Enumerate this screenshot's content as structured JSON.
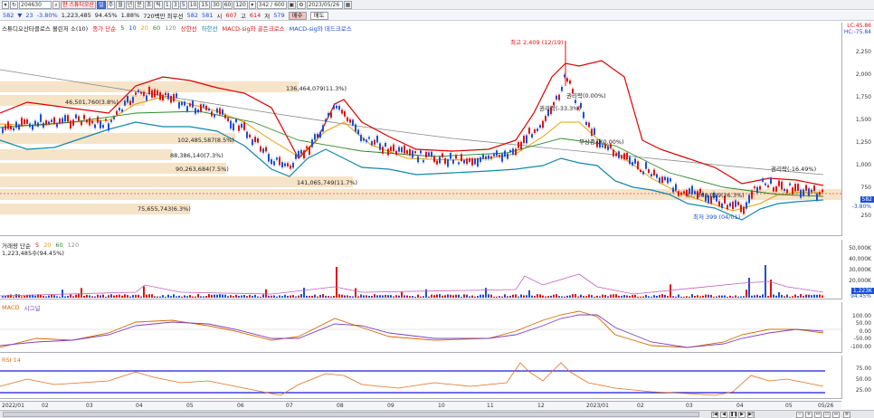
{
  "toolbar": {
    "code": "204630",
    "name": "한 스튜디오산",
    "periods": [
      "주",
      "월",
      "년",
      "분",
      "초",
      "틱"
    ],
    "intervals": [
      "1",
      "3",
      "5",
      "10",
      "15",
      "30",
      "60",
      "120"
    ],
    "count": "342 / 600",
    "date": "2023/05/26"
  },
  "info": {
    "price": "582",
    "change": "23",
    "change_pct": "-3.80%",
    "volume": "1,223,485",
    "vol_pct": "94.45%",
    "turnover": "1.88%",
    "label": "720백만 최우선",
    "ask": "582",
    "bid": "581",
    "high_label": "시",
    "high": "607",
    "close_label": "고",
    "close": "614",
    "low_label": "저",
    "low": "579",
    "buy_btn": "매수",
    "sell_btn": "매도"
  },
  "price_legend": {
    "name": "스튜디오산타클로스 볼린저 소(10)",
    "ma_label": "종가 단순",
    "ma": [
      "5",
      "10",
      "20",
      "60",
      "120"
    ],
    "up": "상한선",
    "down": "하한선",
    "macd1": "MACD-sig와 골든크로스",
    "macd2": "MACD-sig와 데드크로스"
  },
  "price_axis": {
    "ticks": [
      "2,250",
      "2,000",
      "1,750",
      "1,500",
      "1,250",
      "1,000",
      "750",
      "500",
      "250"
    ],
    "lc": "LC:45.86",
    "hc": "HC:-75.84",
    "tag1": "582",
    "tag2": "-3.80%"
  },
  "annotations": {
    "a1": "136,464,079(11.3%)",
    "a2": "46,501,760(3.8%)",
    "a3": "102,485,587(8.5%)",
    "a4": "88,386,140(7.3%)",
    "a5": "90,263,684(7.5%)",
    "a6": "75,655,743(6.3%)",
    "a7": "141,065,749(11.7%)",
    "a8": "최고 2,409 (12/19)",
    "a9": "권리락(0.00%)",
    "a10": "권리락(-33.3%)",
    "a11": "무상증자(0.00%)",
    "a12": "권리락(-16.49%)",
    "a13": "최저 399 (04/01)",
    "a14": "(?, 368,019(26.3%)"
  },
  "volume_legend": {
    "label": "거래량 단순",
    "ma": [
      "5",
      "20",
      "60",
      "120"
    ],
    "value": "1,223,485수(94.45%)"
  },
  "volume_axis": {
    "ticks": [
      "50,000K",
      "40,000K",
      "30,000K",
      "20,000K",
      "10,000K"
    ],
    "tag1": "1,223K",
    "tag2": "94.45%"
  },
  "macd_legend": {
    "label": "MACD",
    "sig": "시그널"
  },
  "macd_axis": {
    "ticks": [
      "100.00",
      "50.00",
      "0.00",
      "-50.00",
      "-100.00"
    ]
  },
  "rsi_legend": {
    "label": "RSI 14"
  },
  "rsi_axis": {
    "ticks": [
      "75.00",
      "50.00",
      "25.00"
    ]
  },
  "xaxis": [
    "2022/01",
    "02",
    "03",
    "04",
    "05",
    "06",
    "07",
    "08",
    "09",
    "10",
    "11",
    "12",
    "2023/01",
    "02",
    "03",
    "04",
    "05",
    "05/26"
  ]
}
